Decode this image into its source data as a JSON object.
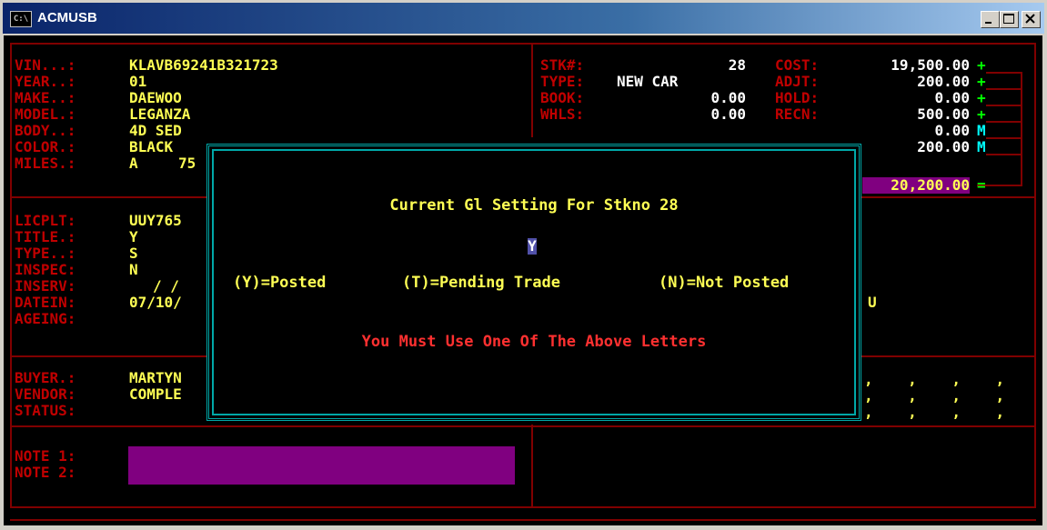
{
  "window": {
    "title": "ACMUSB",
    "icon": "console-icon",
    "icon_text": "C:\\"
  },
  "vehicle": {
    "vin_label": "VIN...:",
    "vin": "KLAVB69241B321723",
    "year_label": "YEAR..:",
    "year": "01",
    "make_label": "MAKE..:",
    "make": "DAEWOO",
    "model_label": "MODEL.:",
    "model": "LEGANZA",
    "body_label": "BODY..:",
    "body": "4D SED",
    "color_label": "COLOR.:",
    "color": "BLACK",
    "miles_label": "MILES.:",
    "miles_flag": "A",
    "miles": "75"
  },
  "stock": {
    "stk_label": "STK#:",
    "stk": "28",
    "type_label": "TYPE:",
    "type": "NEW CAR",
    "book_label": "BOOK:",
    "book": "0.00",
    "whls_label": "WHLS:",
    "whls": "0.00"
  },
  "costs": {
    "cost_label": "COST:",
    "cost": "19,500.00",
    "cost_mark": "+",
    "adjt_label": "ADJT:",
    "adjt": "200.00",
    "adjt_mark": "+",
    "hold_label": "HOLD:",
    "hold": "0.00",
    "hold_mark": "+",
    "recn_label": "RECN:",
    "recn": "500.00",
    "recn_mark": "+",
    "row5": "0.00",
    "row5_mark": "M",
    "row6": "200.00",
    "row6_mark": "M",
    "total": "20,200.00",
    "total_mark": "="
  },
  "title_info": {
    "licplt_label": "LICPLT:",
    "licplt": "UUY765",
    "title_label": "TITLE.:",
    "title": "Y",
    "type_label": "TYPE..:",
    "type": "S",
    "inspec_label": "INSPEC:",
    "inspec": "N",
    "inserv_label": "INSERV:",
    "inserv": "/ /",
    "datein_label": "DATEIN:",
    "datein": "07/10/",
    "ageing_label": "AGEING:",
    "right_letter": "U"
  },
  "parties": {
    "buyer_label": "BUYER.:",
    "buyer": "MARTYN",
    "vendor_label": "VENDOR:",
    "vendor": "COMPLE",
    "status_label": "STATUS:",
    "marks": ",",
    "marks_row": ",    ,    ,    ,"
  },
  "notes": {
    "note1_label": "NOTE 1:",
    "note2_label": "NOTE 2:"
  },
  "dialog": {
    "heading": "Current Gl Setting For Stkno 28",
    "value": "Y",
    "option_y": "(Y)=Posted",
    "option_t": "(T)=Pending Trade",
    "option_n": "(N)=Not Posted",
    "error": "You Must Use One Of The Above Letters"
  }
}
